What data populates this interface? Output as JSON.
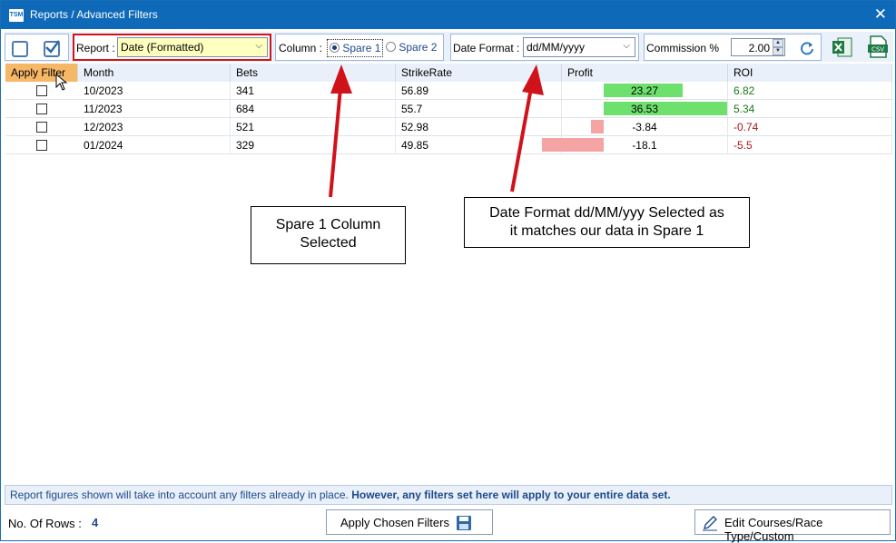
{
  "window": {
    "app_icon": "TSM",
    "title": "Reports / Advanced Filters",
    "close_glyph": "✕"
  },
  "toolbar": {
    "report_label": "Report :",
    "report_value": "Date (Formatted)",
    "column_label": "Column :",
    "column_options": [
      "Spare 1",
      "Spare 2"
    ],
    "column_selected": "Spare 1",
    "date_format_label": "Date Format :",
    "date_format_value": "dd/MM/yyyy",
    "commission_label": "Commission %",
    "commission_value": "2.00",
    "icons": [
      "uncheck-all-icon",
      "check-all-icon",
      "refresh-icon",
      "excel-export-icon",
      "csv-export-icon"
    ]
  },
  "grid": {
    "columns": [
      "Apply Filter",
      "Month",
      "Bets",
      "StrikeRate",
      "Profit",
      "ROI"
    ],
    "rows": [
      {
        "month": "10/2023",
        "bets": "341",
        "strike_rate": "56.89",
        "profit": 23.27,
        "profit_text": "23.27",
        "roi": "6.82"
      },
      {
        "month": "11/2023",
        "bets": "684",
        "strike_rate": "55.7",
        "profit": 36.53,
        "profit_text": "36.53",
        "roi": "5.34"
      },
      {
        "month": "12/2023",
        "bets": "521",
        "strike_rate": "52.98",
        "profit": -3.84,
        "profit_text": "-3.84",
        "roi": "-0.74"
      },
      {
        "month": "01/2024",
        "bets": "329",
        "strike_rate": "49.85",
        "profit": -18.1,
        "profit_text": "-18.1",
        "roi": "-5.5"
      }
    ]
  },
  "annotations": {
    "callout_1_line1": "Spare 1 Column",
    "callout_1_line2": "Selected",
    "callout_2_line1": "Date Format dd/MM/yyy Selected as",
    "callout_2_line2": "it matches our data in Spare 1"
  },
  "footer": {
    "note_plain": "Report figures shown will take into account any filters already in place.",
    "note_bold": "However, any filters set here will apply to your entire data set.",
    "rows_label": "No. Of Rows  :",
    "rows_count": "4",
    "apply_button": "Apply Chosen Filters",
    "edit_button": "Edit Courses/Race Type/Custom"
  },
  "colors": {
    "titlebar": "#0e6ab8",
    "positive_bar": "#6ee06e",
    "negative_bar": "#f5a3a3",
    "positive_text": "#1a7a1a",
    "negative_text": "#a8181e",
    "annotation_arrow": "#d0131b",
    "highlight_border": "#d0131b"
  }
}
